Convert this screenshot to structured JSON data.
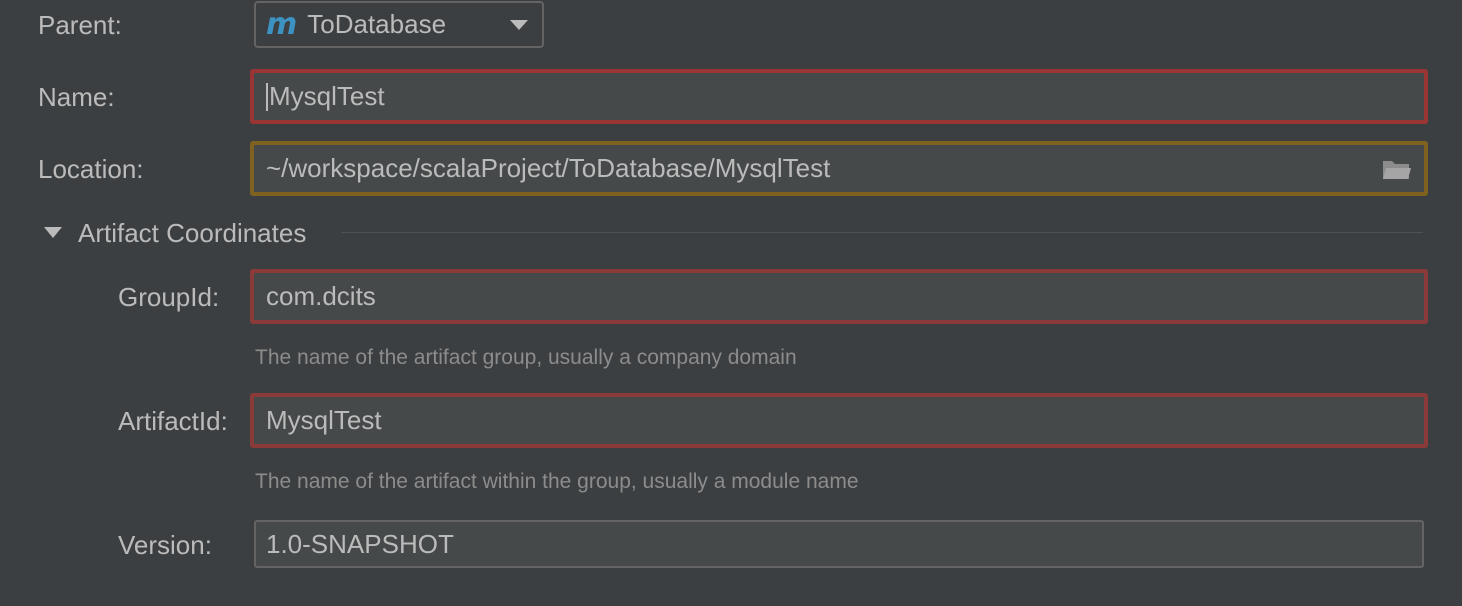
{
  "parent": {
    "label": "Parent:",
    "value": "ToDatabase",
    "icon": "maven-module-icon"
  },
  "name": {
    "label": "Name:",
    "value": "MysqlTest"
  },
  "location": {
    "label": "Location:",
    "value": "~/workspace/scalaProject/ToDatabase/MysqlTest",
    "icon": "folder-icon"
  },
  "artifact_coordinates": {
    "title": "Artifact Coordinates",
    "expanded": true,
    "group_id": {
      "label": "GroupId:",
      "value": "com.dcits",
      "hint": "The name of the artifact group, usually a company domain"
    },
    "artifact_id": {
      "label": "ArtifactId:",
      "value": "MysqlTest",
      "hint": "The name of the artifact within the group, usually a module name"
    },
    "version": {
      "label": "Version:",
      "value": "1.0-SNAPSHOT"
    }
  },
  "colors": {
    "background": "#3c3f41",
    "error_border": "#9a3535",
    "warning_border": "#7f6220",
    "maven_icon": "#3c93c2"
  }
}
